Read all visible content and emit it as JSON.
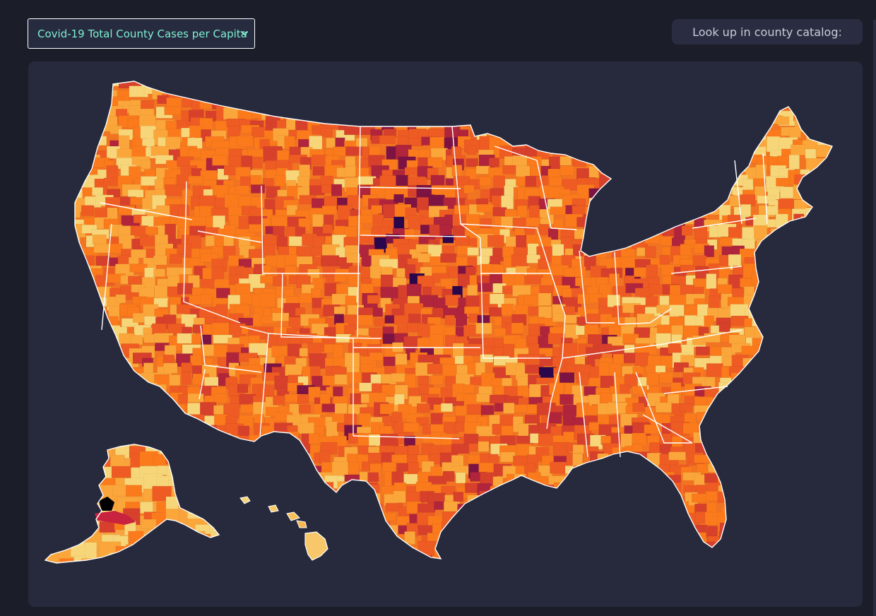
{
  "header": {
    "metric_select": {
      "selected": "Covid-19 Total County Cases per Capita",
      "icon": "chevron-down-icon"
    },
    "catalog_button": {
      "label": "Look up in county catalog:"
    }
  },
  "map": {
    "projection": "Albers USA",
    "color_scale": [
      "#f7d679",
      "#fba63a",
      "#fa7a1c",
      "#ee5b23",
      "#d7402b",
      "#b0253b",
      "#7d1342",
      "#2a064d",
      "#000000"
    ],
    "colors": {
      "app_background": "#1b1d29",
      "panel_background": "#272a3d",
      "state_borders": "#ffffff",
      "select_text": "#7ef0d2"
    }
  }
}
